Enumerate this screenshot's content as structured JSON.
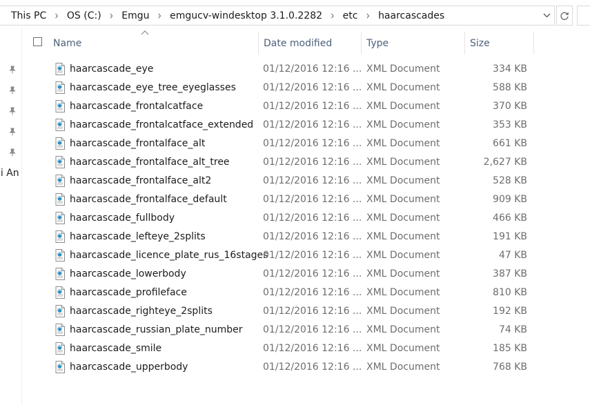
{
  "address_bar": {
    "crumbs": [
      "This PC",
      "OS (C:)",
      "Emgu",
      "emgucv-windesktop 3.1.0.2282",
      "etc",
      "haarcascades"
    ]
  },
  "nav": {
    "partial_label": "ni An"
  },
  "icons": {
    "chevron": "chevron-right-icon",
    "dropdown": "chevron-down-icon",
    "refresh": "refresh-icon",
    "pin": "pin-icon",
    "file": "xml-file-icon"
  },
  "columns": {
    "name": "Name",
    "date": "Date modified",
    "type": "Type",
    "size": "Size"
  },
  "files": [
    {
      "name": "haarcascade_eye",
      "date": "01/12/2016 12:16 ...",
      "type": "XML Document",
      "size": "334 KB"
    },
    {
      "name": "haarcascade_eye_tree_eyeglasses",
      "date": "01/12/2016 12:16 ...",
      "type": "XML Document",
      "size": "588 KB"
    },
    {
      "name": "haarcascade_frontalcatface",
      "date": "01/12/2016 12:16 ...",
      "type": "XML Document",
      "size": "370 KB"
    },
    {
      "name": "haarcascade_frontalcatface_extended",
      "date": "01/12/2016 12:16 ...",
      "type": "XML Document",
      "size": "353 KB"
    },
    {
      "name": "haarcascade_frontalface_alt",
      "date": "01/12/2016 12:16 ...",
      "type": "XML Document",
      "size": "661 KB"
    },
    {
      "name": "haarcascade_frontalface_alt_tree",
      "date": "01/12/2016 12:16 ...",
      "type": "XML Document",
      "size": "2,627 KB"
    },
    {
      "name": "haarcascade_frontalface_alt2",
      "date": "01/12/2016 12:16 ...",
      "type": "XML Document",
      "size": "528 KB"
    },
    {
      "name": "haarcascade_frontalface_default",
      "date": "01/12/2016 12:16 ...",
      "type": "XML Document",
      "size": "909 KB"
    },
    {
      "name": "haarcascade_fullbody",
      "date": "01/12/2016 12:16 ...",
      "type": "XML Document",
      "size": "466 KB"
    },
    {
      "name": "haarcascade_lefteye_2splits",
      "date": "01/12/2016 12:16 ...",
      "type": "XML Document",
      "size": "191 KB"
    },
    {
      "name": "haarcascade_licence_plate_rus_16stages",
      "date": "01/12/2016 12:16 ...",
      "type": "XML Document",
      "size": "47 KB"
    },
    {
      "name": "haarcascade_lowerbody",
      "date": "01/12/2016 12:16 ...",
      "type": "XML Document",
      "size": "387 KB"
    },
    {
      "name": "haarcascade_profileface",
      "date": "01/12/2016 12:16 ...",
      "type": "XML Document",
      "size": "810 KB"
    },
    {
      "name": "haarcascade_righteye_2splits",
      "date": "01/12/2016 12:16 ...",
      "type": "XML Document",
      "size": "192 KB"
    },
    {
      "name": "haarcascade_russian_plate_number",
      "date": "01/12/2016 12:16 ...",
      "type": "XML Document",
      "size": "74 KB"
    },
    {
      "name": "haarcascade_smile",
      "date": "01/12/2016 12:16 ...",
      "type": "XML Document",
      "size": "185 KB"
    },
    {
      "name": "haarcascade_upperbody",
      "date": "01/12/2016 12:16 ...",
      "type": "XML Document",
      "size": "768 KB"
    }
  ]
}
